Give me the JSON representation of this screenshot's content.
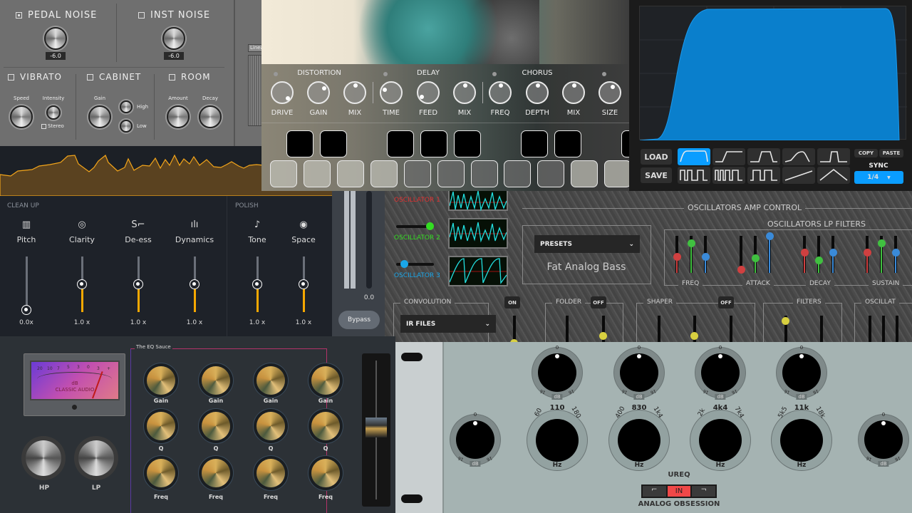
{
  "amp_sim": {
    "pedal_noise": {
      "label": "PEDAL NOISE",
      "checked": true,
      "value": "-6.0"
    },
    "inst_noise": {
      "label": "INST NOISE",
      "checked": false,
      "value": "-6.0"
    },
    "vibrato": {
      "label": "VIBRATO",
      "speed": "Speed",
      "intensity": "Intensity",
      "stereo": "Stereo"
    },
    "cabinet": {
      "label": "CABINET",
      "gain": "Gain",
      "high": "High",
      "low": "Low"
    },
    "room": {
      "label": "ROOM",
      "amount": "Amount",
      "decay": "Decay"
    },
    "mode_dropdown": "Linea"
  },
  "fx": {
    "sections": [
      "DISTORTION",
      "DELAY",
      "CHORUS"
    ],
    "knobs": [
      "DRIVE",
      "GAIN",
      "MIX",
      "TIME",
      "FEED",
      "MIX",
      "FREQ",
      "DEPTH",
      "MIX",
      "SIZE"
    ]
  },
  "lfo": {
    "load": "LOAD",
    "save": "SAVE",
    "copy": "COPY",
    "paste": "PASTE",
    "sync_label": "SYNC",
    "sync_value": "1/4",
    "accent": "#0a9dff",
    "selected_shape": 0
  },
  "vocal": {
    "clean_up": "CLEAN UP",
    "polish": "POLISH",
    "modules": [
      {
        "label": "Pitch",
        "icon": "piano-keys-icon",
        "value": "0.0x",
        "level": 0
      },
      {
        "label": "Clarity",
        "icon": "eye-focus-icon",
        "value": "1.0 x",
        "level": 0.5
      },
      {
        "label": "De-ess",
        "icon": "de-ess-icon",
        "value": "1.0 x",
        "level": 0.5
      },
      {
        "label": "Dynamics",
        "icon": "waveform-icon",
        "value": "1.0 x",
        "level": 0.5
      },
      {
        "label": "Tone",
        "icon": "ear-icon",
        "value": "1.0 x",
        "level": 0.5
      },
      {
        "label": "Space",
        "icon": "target-rings-icon",
        "value": "1.0 x",
        "level": 0.5
      }
    ],
    "output_value": "0.0",
    "bypass": "Bypass",
    "accent": "#f6a800"
  },
  "synth": {
    "oscillators": [
      {
        "label": "OSCILLATOR 1",
        "color": "#e03030"
      },
      {
        "label": "OSCILLATOR 2",
        "color": "#33dd22"
      },
      {
        "label": "OSCILLATOR 3",
        "color": "#1aa6e8"
      }
    ],
    "amp_control": "OSCILLATORS AMP CONTROL",
    "presets_label": "PRESETS",
    "preset_name": "Fat Analog Bass",
    "lp_filters": "OSCILLATORS LP FILTERS",
    "filter_groups": [
      "FREQ",
      "ATTACK",
      "DECAY",
      "SUSTAIN"
    ],
    "modules": [
      {
        "label": "CONVOLUTION",
        "state": "ON"
      },
      {
        "label": "FOLDER",
        "state": "OFF"
      },
      {
        "label": "SHAPER",
        "state": "OFF"
      },
      {
        "label": "FILTERS",
        "state": ""
      },
      {
        "label": "OSCILLAT",
        "state": ""
      }
    ],
    "ir_files": "IR FILES"
  },
  "eq_sauce": {
    "title": "The EQ Sauce",
    "meter_unit": "dB",
    "meter_brand": "CLASSIC AUDIO",
    "meter_scale": [
      "20",
      "10",
      "7",
      "5",
      "3",
      "0",
      "3",
      "+"
    ],
    "hp": "HP",
    "lp": "LP",
    "rows": [
      "Gain",
      "Q",
      "Freq"
    ]
  },
  "ureq": {
    "gain_zero": "0",
    "db": "dB",
    "range": "16",
    "bands": [
      {
        "low": "60",
        "mid": "110",
        "high": "180"
      },
      {
        "low": "400",
        "mid": "830",
        "high": "1k4"
      },
      {
        "low": "2k",
        "mid": "4k4",
        "high": "7k4"
      },
      {
        "low": "5k5",
        "mid": "11k",
        "high": "18k"
      }
    ],
    "hz": "Hz",
    "name": "UREQ",
    "in": "IN",
    "brand": "ANALOG OBSESSION",
    "in_color": "#f04848"
  }
}
